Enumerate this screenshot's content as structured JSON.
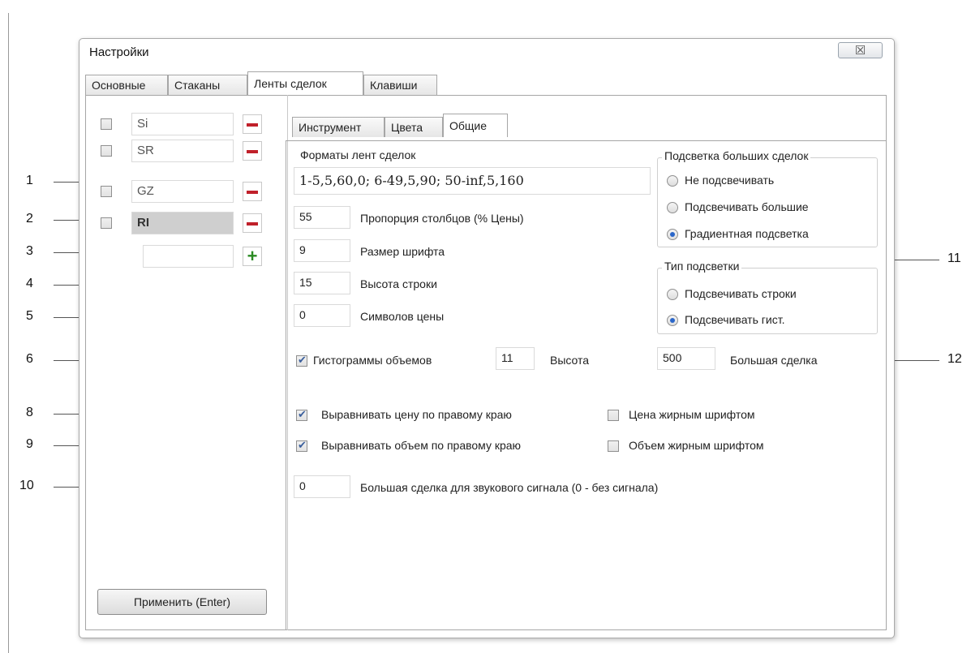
{
  "window": {
    "title": "Настройки",
    "close_glyph": "☒"
  },
  "main_tabs": [
    "Основные",
    "Стаканы",
    "Ленты сделок",
    "Клавиши"
  ],
  "symbols": [
    {
      "name": "Si",
      "checked": false
    },
    {
      "name": "SR",
      "checked": false
    },
    {
      "name": "GZ",
      "checked": false
    },
    {
      "name": "RI",
      "checked": false,
      "selected": true
    },
    {
      "name": "",
      "checked": false
    }
  ],
  "apply_button": "Применить (Enter)",
  "sub_tabs": [
    "Инструмент",
    "Цвета",
    "Общие"
  ],
  "general": {
    "formats_label": "Форматы лент сделок",
    "formats_value": "1-5,5,60,0; 6-49,5,90; 50-inf,5,160",
    "proportion_value": "55",
    "proportion_label": "Пропорция столбцов (% Цены)",
    "font_size_value": "9",
    "font_size_label": "Размер шрифта",
    "row_height_value": "15",
    "row_height_label": "Высота строки",
    "price_digits_value": "0",
    "price_digits_label": "Символов цены",
    "histogram_label": "Гистограммы объемов",
    "histogram_height_value": "11",
    "histogram_height_label": "Высота",
    "big_trade_value": "500",
    "big_trade_label": "Большая сделка",
    "align_price_label": "Выравнивать цену по правому краю",
    "bold_price_label": "Цена жирным шрифтом",
    "align_volume_label": "Выравнивать объем по правому краю",
    "bold_volume_label": "Объем жирным шрифтом",
    "sound_value": "0",
    "sound_label": "Большая сделка для звукового сигнала (0 - без сигнала)",
    "highlight_group": {
      "title": "Подсветка больших сделок",
      "options": [
        "Не подсвечивать",
        "Подсвечивать большие",
        "Градиентная подсветка"
      ]
    },
    "highlight_type_group": {
      "title": "Тип подсветки",
      "options": [
        "Подсвечивать строки",
        "Подсвечивать гист."
      ]
    }
  },
  "callouts": [
    "1",
    "2",
    "3",
    "4",
    "5",
    "6",
    "8",
    "9",
    "10",
    "11",
    "12"
  ],
  "icons": {
    "remove": "minus-icon",
    "add": "plus-icon",
    "close": "close-icon"
  },
  "colors": {
    "remove": "#c0202a",
    "add": "#2a8a22",
    "radio_selected": "#2a66c9"
  }
}
